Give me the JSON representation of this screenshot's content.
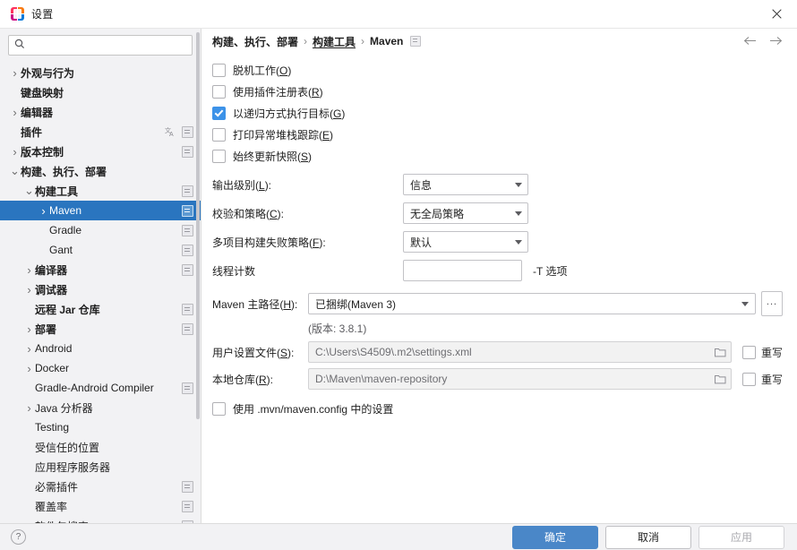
{
  "window": {
    "title": "设置",
    "app_icon": "intellij-idea-icon",
    "close_label": "×"
  },
  "search": {
    "value": "",
    "placeholder": "",
    "icon": "search-icon"
  },
  "sidebar": {
    "items": [
      {
        "label": "外观与行为",
        "indent": 0,
        "arrow": "collapsed",
        "bold": true,
        "badge": false,
        "lang": false,
        "selected": false
      },
      {
        "label": "键盘映射",
        "indent": 0,
        "arrow": "none",
        "bold": true,
        "badge": false,
        "lang": false,
        "selected": false
      },
      {
        "label": "编辑器",
        "indent": 0,
        "arrow": "collapsed",
        "bold": true,
        "badge": false,
        "lang": false,
        "selected": false
      },
      {
        "label": "插件",
        "indent": 0,
        "arrow": "none",
        "bold": true,
        "badge": true,
        "lang": true,
        "selected": false
      },
      {
        "label": "版本控制",
        "indent": 0,
        "arrow": "collapsed",
        "bold": true,
        "badge": true,
        "lang": false,
        "selected": false
      },
      {
        "label": "构建、执行、部署",
        "indent": 0,
        "arrow": "expanded",
        "bold": true,
        "badge": false,
        "lang": false,
        "selected": false
      },
      {
        "label": "构建工具",
        "indent": 1,
        "arrow": "expanded",
        "bold": true,
        "badge": true,
        "lang": false,
        "selected": false
      },
      {
        "label": "Maven",
        "indent": 2,
        "arrow": "collapsed",
        "bold": false,
        "badge": true,
        "lang": false,
        "selected": true
      },
      {
        "label": "Gradle",
        "indent": 2,
        "arrow": "none",
        "bold": false,
        "badge": true,
        "lang": false,
        "selected": false
      },
      {
        "label": "Gant",
        "indent": 2,
        "arrow": "none",
        "bold": false,
        "badge": true,
        "lang": false,
        "selected": false
      },
      {
        "label": "编译器",
        "indent": 1,
        "arrow": "collapsed",
        "bold": true,
        "badge": true,
        "lang": false,
        "selected": false
      },
      {
        "label": "调试器",
        "indent": 1,
        "arrow": "collapsed",
        "bold": true,
        "badge": false,
        "lang": false,
        "selected": false
      },
      {
        "label": "远程 Jar 仓库",
        "indent": 1,
        "arrow": "none",
        "bold": true,
        "badge": true,
        "lang": false,
        "selected": false
      },
      {
        "label": "部署",
        "indent": 1,
        "arrow": "collapsed",
        "bold": true,
        "badge": true,
        "lang": false,
        "selected": false
      },
      {
        "label": "Android",
        "indent": 1,
        "arrow": "collapsed",
        "bold": false,
        "badge": false,
        "lang": false,
        "selected": false
      },
      {
        "label": "Docker",
        "indent": 1,
        "arrow": "collapsed",
        "bold": false,
        "badge": false,
        "lang": false,
        "selected": false
      },
      {
        "label": "Gradle-Android Compiler",
        "indent": 1,
        "arrow": "none",
        "bold": false,
        "badge": true,
        "lang": false,
        "selected": false
      },
      {
        "label": "Java 分析器",
        "indent": 1,
        "arrow": "collapsed",
        "bold": false,
        "badge": false,
        "lang": false,
        "selected": false
      },
      {
        "label": "Testing",
        "indent": 1,
        "arrow": "none",
        "bold": false,
        "badge": false,
        "lang": false,
        "selected": false
      },
      {
        "label": "受信任的位置",
        "indent": 1,
        "arrow": "none",
        "bold": false,
        "badge": false,
        "lang": false,
        "selected": false
      },
      {
        "label": "应用程序服务器",
        "indent": 1,
        "arrow": "none",
        "bold": false,
        "badge": false,
        "lang": false,
        "selected": false
      },
      {
        "label": "必需插件",
        "indent": 1,
        "arrow": "none",
        "bold": false,
        "badge": true,
        "lang": false,
        "selected": false
      },
      {
        "label": "覆盖率",
        "indent": 1,
        "arrow": "none",
        "bold": false,
        "badge": true,
        "lang": false,
        "selected": false
      },
      {
        "label": "软件包搜索",
        "indent": 1,
        "arrow": "none",
        "bold": false,
        "badge": true,
        "lang": false,
        "selected": false
      }
    ]
  },
  "breadcrumb": {
    "parts": [
      "构建、执行、部署",
      "构建工具",
      "Maven"
    ],
    "separator": "›",
    "back_icon": "arrow-left-icon",
    "forward_icon": "arrow-right-icon"
  },
  "main": {
    "checkboxes": [
      {
        "label": "脱机工作(",
        "mnemonic": "O",
        "suffix": ")",
        "checked": false
      },
      {
        "label": "使用插件注册表(",
        "mnemonic": "R",
        "suffix": ")",
        "checked": false
      },
      {
        "label": "以递归方式执行目标(",
        "mnemonic": "G",
        "suffix": ")",
        "checked": true
      },
      {
        "label": "打印异常堆栈跟踪(",
        "mnemonic": "E",
        "suffix": ")",
        "checked": false
      },
      {
        "label": "始终更新快照(",
        "mnemonic": "S",
        "suffix": ")",
        "checked": false
      }
    ],
    "output_level": {
      "label": "输出级别(",
      "mnemonic": "L",
      "suffix": "):",
      "value": "信息"
    },
    "checksum_policy": {
      "label": "校验和策略(",
      "mnemonic": "C",
      "suffix": "):",
      "value": "无全局策略"
    },
    "multiproject_fail_policy": {
      "label": "多项目构建失败策略(",
      "mnemonic": "F",
      "suffix": "):",
      "value": "默认"
    },
    "thread_count": {
      "label": "线程计数",
      "value": "",
      "suffix_note": "-T 选项"
    },
    "maven_home": {
      "label": "Maven 主路径(",
      "mnemonic": "H",
      "suffix": "):",
      "value": "已捆绑(Maven 3)",
      "browse_label": "...",
      "version_note": "(版本: 3.8.1)"
    },
    "user_settings_file": {
      "label": "用户设置文件(",
      "mnemonic": "S",
      "suffix": "):",
      "value": "C:\\Users\\S4509\\.m2\\settings.xml",
      "override_label": "重写",
      "override_checked": false,
      "browse_icon": "folder-icon"
    },
    "local_repository": {
      "label": "本地仓库(",
      "mnemonic": "R",
      "suffix": "):",
      "value": "D:\\Maven\\maven-repository",
      "override_label": "重写",
      "override_checked": false,
      "browse_icon": "folder-icon"
    },
    "mvn_config": {
      "label": "使用 .mvn/maven.config 中的设置",
      "checked": false
    }
  },
  "footer": {
    "help_icon": "help-icon",
    "ok_label": "确定",
    "cancel_label": "取消",
    "apply_label": "应用"
  },
  "colors": {
    "selection_blue": "#2a75bf",
    "checkbox_blue": "#3c92e8",
    "primary_button": "#4a87c8",
    "sidebar_bg": "#f2f2f4"
  }
}
